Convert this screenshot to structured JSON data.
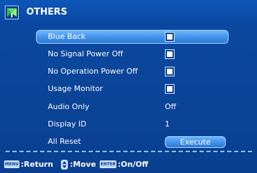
{
  "header": {
    "title": "OTHERS",
    "icon": "others-menu-icon"
  },
  "rows": [
    {
      "label": "Blue Back",
      "control": "checkbox"
    },
    {
      "label": "No Signal Power Off",
      "control": "checkbox"
    },
    {
      "label": "No Operation Power Off",
      "control": "checkbox"
    },
    {
      "label": "Usage Monitor",
      "control": "checkbox"
    },
    {
      "label": "Audio Only",
      "control": "value",
      "value": "Off"
    },
    {
      "label": "Display ID",
      "control": "value",
      "value": "1"
    },
    {
      "label": "All Reset",
      "control": "button",
      "button_label": "Execute"
    }
  ],
  "selected_row": "Blue Back",
  "footer": {
    "menu_key": "MENU",
    "return_label": ":Return",
    "move_label": ":Move",
    "enter_key": "ENTER",
    "onoff_label": ":On/Off"
  },
  "colors": {
    "background": "#0a3f8f",
    "highlight": "#3d8fe8",
    "text": "#ffffff"
  }
}
